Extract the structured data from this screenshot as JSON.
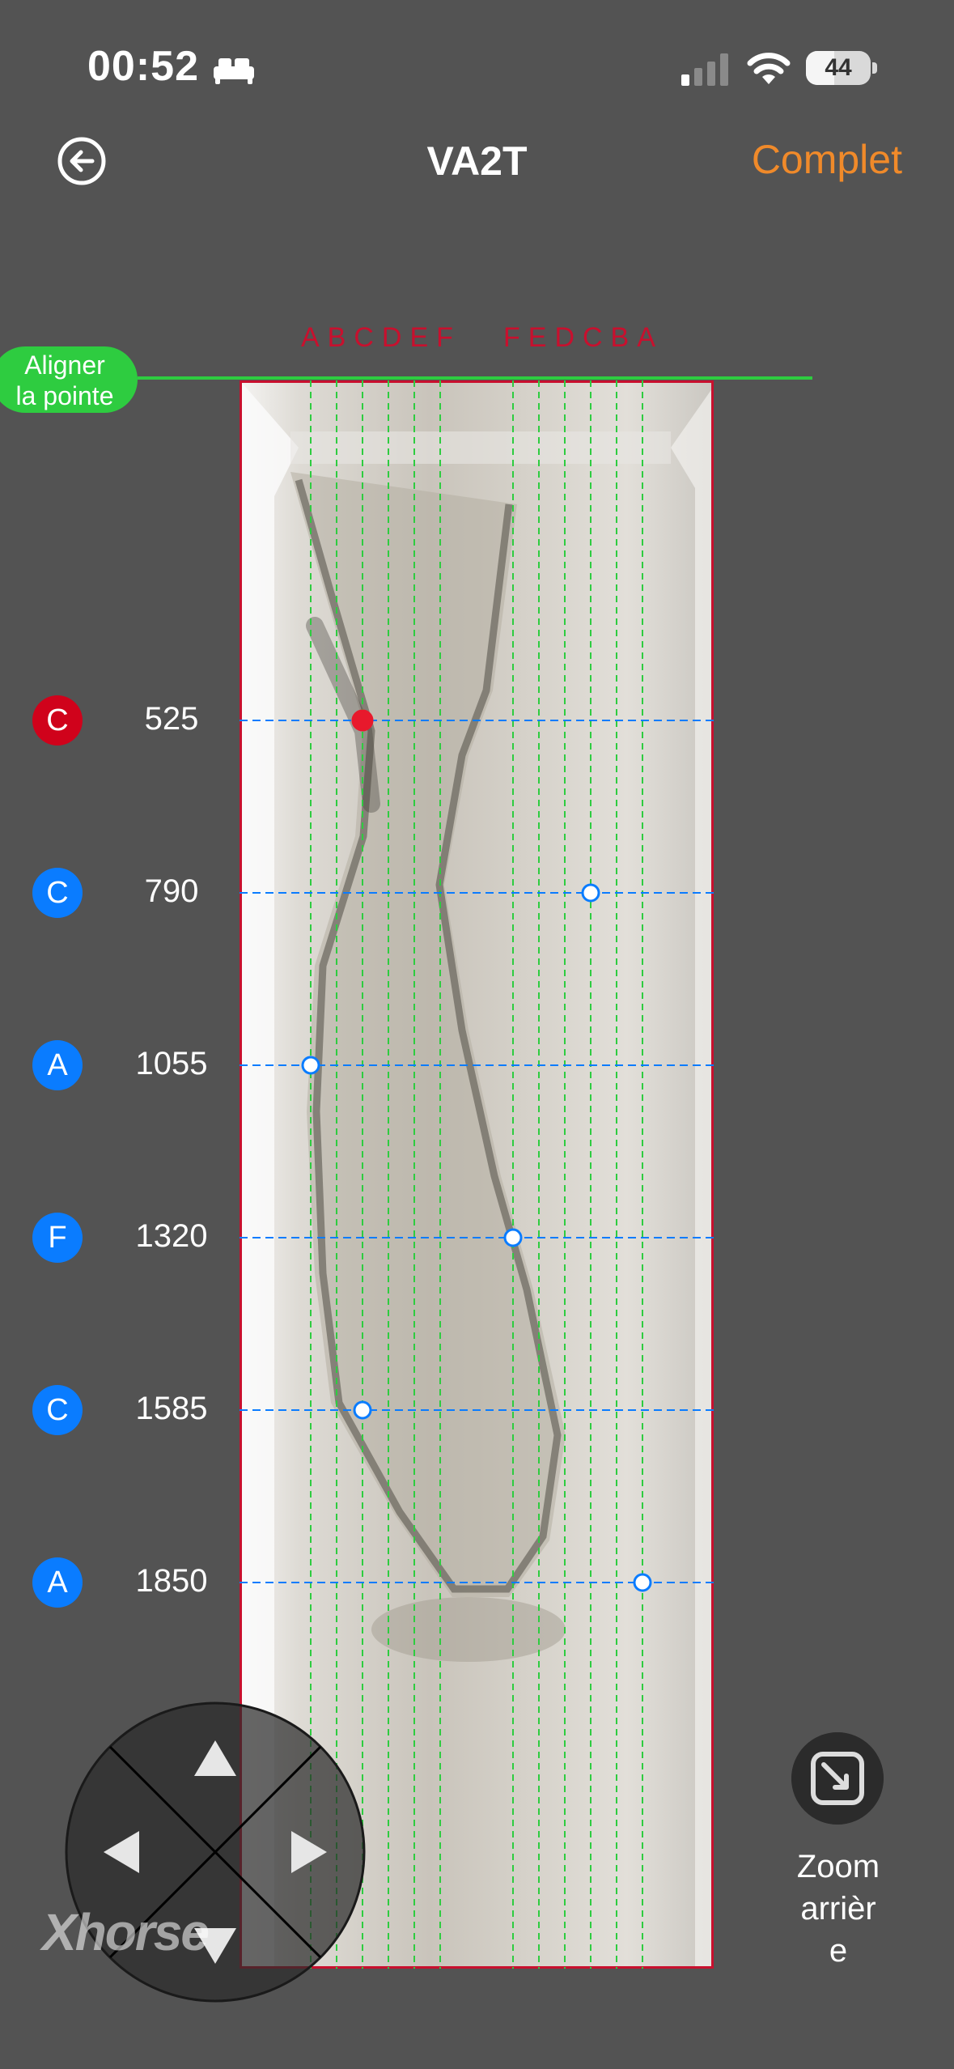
{
  "status_bar": {
    "time": "00:52",
    "battery": "44",
    "battery_level": 0.44,
    "signal_bars_active": 1
  },
  "header": {
    "title": "VA2T",
    "complete_label": "Complet"
  },
  "key_view": {
    "columns_left": "ABCDEF",
    "columns_right": "FEDCBA",
    "align_tip_label": [
      "Aligner",
      "la pointe"
    ]
  },
  "cuts": [
    {
      "letter": "C",
      "value": "525",
      "selected": true,
      "color": "#d0021b"
    },
    {
      "letter": "C",
      "value": "790",
      "selected": false,
      "color": "#0a7cff"
    },
    {
      "letter": "A",
      "value": "1055",
      "selected": false,
      "color": "#0a7cff"
    },
    {
      "letter": "F",
      "value": "1320",
      "selected": false,
      "color": "#0a7cff"
    },
    {
      "letter": "C",
      "value": "1585",
      "selected": false,
      "color": "#0a7cff"
    },
    {
      "letter": "A",
      "value": "1850",
      "selected": false,
      "color": "#0a7cff"
    }
  ],
  "controls": {
    "brand_logo": "Xhorse",
    "zoom_label": [
      "Zoom",
      "arrièr",
      "e"
    ]
  },
  "colors": {
    "accent": "#f08a2a",
    "guide_green": "#2ecc40",
    "frame_red": "#c8102e",
    "cut_blue": "#0a7cff"
  }
}
